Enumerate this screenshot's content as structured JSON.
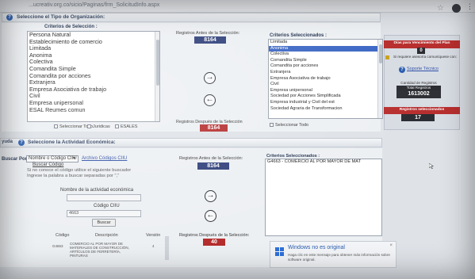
{
  "browser": {
    "url": "...ucreativ.org.co/sicio/Paginas/frm_SolicitudInfo.aspx"
  },
  "org": {
    "header": "Seleccione el Tipo de Organización:",
    "criteria_label": "Criterios de Selección :",
    "items": [
      "Persona Natural",
      "Establecimiento de comercio",
      "Limitada",
      "Anonima",
      "Colectiva",
      "Comandita Simple",
      "Comandita por acciones",
      "Extranjera",
      "Empresa Asociativa de trabajo",
      "Civil",
      "Empresa unipersonal",
      "ESAL Reumes comun"
    ],
    "before_label": "Registros Antes de la Selección:",
    "before_count": "8164",
    "after_label": "Registros Después de la Selección",
    "after_count": "8164",
    "selected_label": "Criterios Seleccionados :",
    "selected_items": [
      "Limitada",
      "Anonima",
      "Colectiva",
      "Comandita Simple",
      "Comandita por acciones",
      "Extranjera",
      "Empresa Asociativa de trabajo",
      "Civil",
      "Empresa unipersonal",
      "Sociedad por Acciones Simplificada",
      "Empresa industrial y Civil del est",
      "Sociedad Agraria de Transformacion"
    ],
    "checkboxes": [
      "Seleccionar Todo",
      "Juridicas",
      "ESALES"
    ],
    "select_all_right": "Seleccionar Todo"
  },
  "sidebar": {
    "days_label": "Días para Vencimiento del Plan",
    "days_value": "0",
    "help_text": "Si requiere asesoría comuníquese con:",
    "support_link": "Soporte Técnico",
    "records_label": "Cantidad de Registros",
    "total_label": "Total Registros",
    "total_value": "1613002",
    "selected_label": "Registros seleccionados",
    "selected_value": "17"
  },
  "activity": {
    "header_prefix": "yuda",
    "header": "Seleccione la Actividad Económica:",
    "search_label": "Buscar Por :",
    "search_option": "Nombre o Código CIIU",
    "ciiu_link": "Archivo Códigos CIIU",
    "search_code_label": "Buscar Código",
    "help1": "Si no conoce el código utilice el siguiente buscador",
    "help2": "Ingrese la palabra a buscar separadas por \",\"",
    "name_label": "Nombre de la actividad económica",
    "code_label": "Código CIIU",
    "code_value": "4663",
    "search_button": "Buscar",
    "table_headers": [
      "Código",
      "Descripción",
      "Versión"
    ],
    "table_row": {
      "code": "G4663",
      "description": "COMERCIO AL POR MAYOR DE MATERIALES DE CONSTRUCCIÓN, ARTÍCULOS DE FERRETERÍA, PINTURAS",
      "version": "4"
    },
    "before_label": "Registros Antes de la Selección:",
    "before_count": "8164",
    "after_label": "Registros Después de la Selección:",
    "after_count": "40",
    "selected_label": "Criterios Seleccionados :",
    "selected_items": [
      "G4663 - COMERCIO AL POR MAYOR DE MAT"
    ]
  },
  "windows": {
    "title": "Windows no es original",
    "message": "Haga clic en este mensaje para obtener más información sobre software original."
  }
}
